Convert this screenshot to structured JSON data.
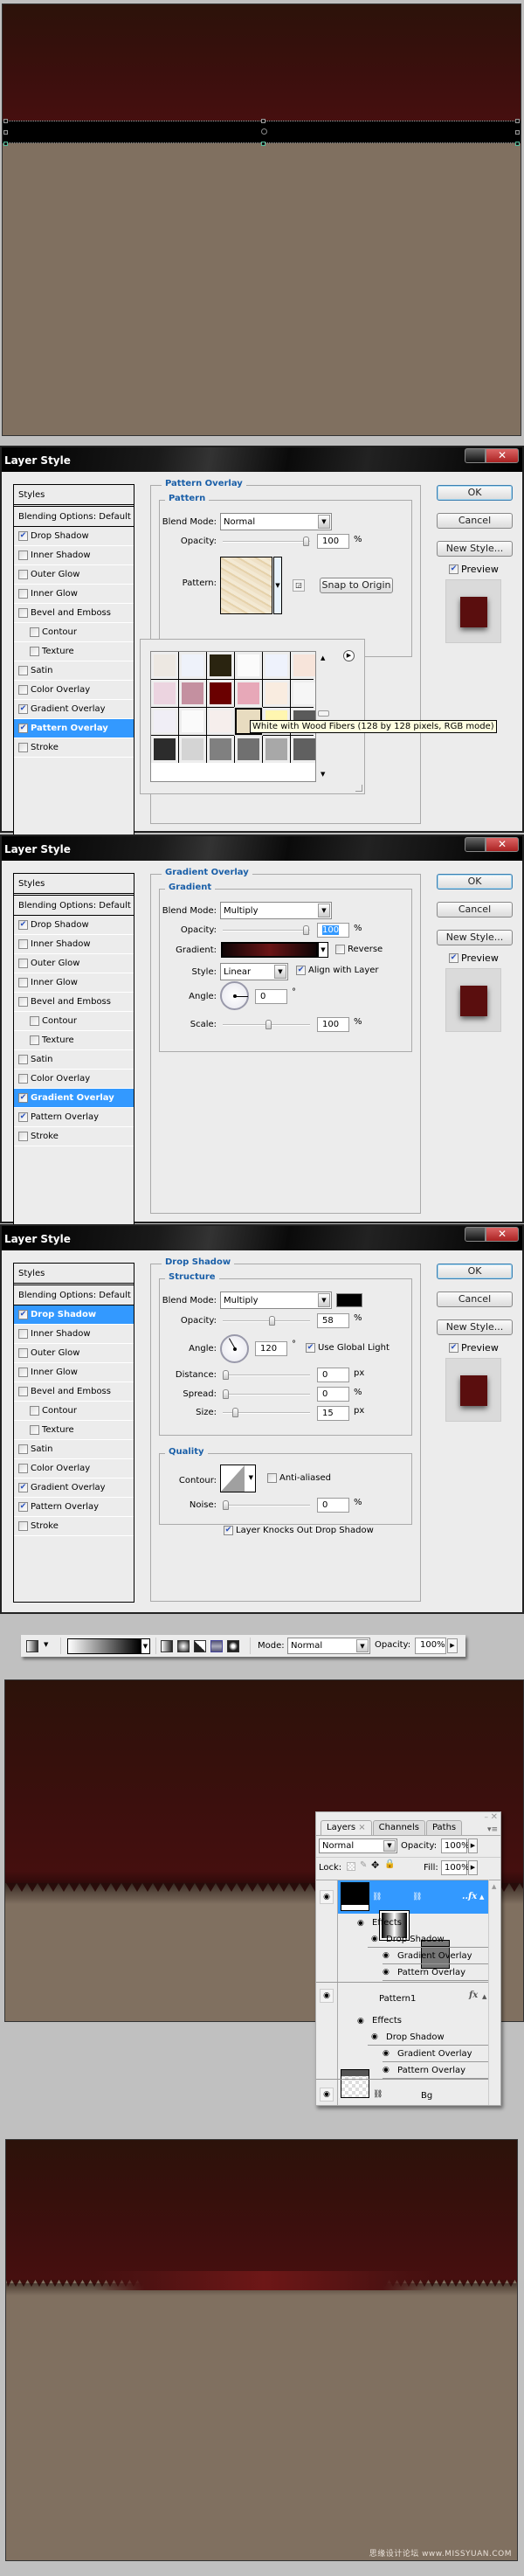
{
  "dialogs": [
    {
      "title": "Layer Style",
      "styles_list": {
        "header": "Styles",
        "blending": "Blending Options: Default",
        "items": [
          {
            "label": "Drop Shadow",
            "checked": true
          },
          {
            "label": "Inner Shadow",
            "checked": false
          },
          {
            "label": "Outer Glow",
            "checked": false
          },
          {
            "label": "Inner Glow",
            "checked": false
          },
          {
            "label": "Bevel and Emboss",
            "checked": false
          },
          {
            "label": "Contour",
            "checked": false,
            "sub": true
          },
          {
            "label": "Texture",
            "checked": false,
            "sub": true
          },
          {
            "label": "Satin",
            "checked": false
          },
          {
            "label": "Color Overlay",
            "checked": false
          },
          {
            "label": "Gradient Overlay",
            "checked": true
          },
          {
            "label": "Pattern Overlay",
            "checked": true,
            "active": true
          },
          {
            "label": "Stroke",
            "checked": false
          }
        ]
      },
      "buttons": {
        "ok": "OK",
        "cancel": "Cancel",
        "new_style": "New Style...",
        "preview": "Preview"
      },
      "section": "Pattern Overlay",
      "subsection": "Pattern",
      "blend_mode_label": "Blend Mode:",
      "blend_mode": "Normal",
      "opacity_label": "Opacity:",
      "opacity": "100",
      "opacity_unit": "%",
      "opacity_fraction": 1.0,
      "pattern_label": "Pattern:",
      "snap_to_origin": "Snap to Origin",
      "picker_tooltip": "White with Wood Fibers (128 by 128 pixels, RGB mode)",
      "picker_colors": [
        "#ede8e2",
        "#eef2fa",
        "#2a2410",
        "#fbfbfb",
        "#eef2fc",
        "#f7e4da",
        "#ecd4e0",
        "#c490a0",
        "#6a0000",
        "#e7a8b8",
        "#f9ece0",
        "#f6f6f6",
        "#f0eef6",
        "#fafafa",
        "#f6eeec",
        "#e8dcc0",
        "#fff6b0",
        "#5a5a5a",
        "#2c2c2c",
        "#d4d4d4",
        "#808080",
        "#707070",
        "#a8a8a8",
        "#606060"
      ],
      "picker_selected_index": 15
    },
    {
      "title": "Layer Style",
      "styles_list_active": "Gradient Overlay",
      "section": "Gradient Overlay",
      "subsection": "Gradient",
      "blend_mode_label": "Blend Mode:",
      "blend_mode": "Multiply",
      "opacity_label": "Opacity:",
      "opacity": "100",
      "opacity_unit": "%",
      "opacity_fraction": 1.0,
      "gradient_label": "Gradient:",
      "reverse_label": "Reverse",
      "reverse_checked": false,
      "style_label": "Style:",
      "style": "Linear",
      "align_label": "Align with Layer",
      "align_checked": true,
      "angle_label": "Angle:",
      "angle": "0",
      "angle_unit": "°",
      "scale_label": "Scale:",
      "scale": "100",
      "scale_unit": "%",
      "scale_fraction": 0.53,
      "gradient_colors": [
        "#0e0405",
        "#6a1416",
        "#0e0405"
      ]
    },
    {
      "title": "Layer Style",
      "styles_list_active": "Drop Shadow",
      "section": "Drop Shadow",
      "subsection": "Structure",
      "blend_mode_label": "Blend Mode:",
      "blend_mode": "Multiply",
      "shadow_color": "#000000",
      "opacity_label": "Opacity:",
      "opacity": "58",
      "opacity_unit": "%",
      "opacity_fraction": 0.58,
      "angle_label": "Angle:",
      "angle": "120",
      "angle_unit": "°",
      "global_light_label": "Use Global Light",
      "global_light_checked": true,
      "distance_label": "Distance:",
      "distance": "0",
      "distance_unit": "px",
      "spread_label": "Spread:",
      "spread": "0",
      "spread_unit": "%",
      "size_label": "Size:",
      "size": "15",
      "size_unit": "px",
      "size_fraction": 0.12,
      "quality_title": "Quality",
      "contour_label": "Contour:",
      "anti_aliased_label": "Anti-aliased",
      "anti_aliased_checked": false,
      "noise_label": "Noise:",
      "noise": "0",
      "noise_unit": "%",
      "knockout_label": "Layer Knocks Out Drop Shadow",
      "knockout_checked": true
    }
  ],
  "toolbar": {
    "mode_label": "Mode:",
    "mode": "Normal",
    "opacity_label": "Opacity:",
    "opacity": "100%"
  },
  "layers_panel": {
    "tabs": [
      "Layers",
      "Channels",
      "Paths"
    ],
    "tab_close": "×",
    "blend_mode": "Normal",
    "opacity_label": "Opacity:",
    "opacity": "100%",
    "lock_label": "Lock:",
    "fill_label": "Fill:",
    "fill": "100%",
    "layers": [
      {
        "name": "",
        "fx": "fx",
        "selected": true,
        "effects_label": "Effects",
        "effects": [
          "Drop Shadow",
          "Gradient Overlay",
          "Pattern Overlay"
        ]
      },
      {
        "name": "Pattern1",
        "fx": "fx",
        "selected": false,
        "effects_label": "Effects",
        "effects": [
          "Drop Shadow",
          "Gradient Overlay",
          "Pattern Overlay"
        ]
      },
      {
        "name": "Bg",
        "selected": false
      }
    ]
  },
  "watermark": "思缘设计论坛 www.MISSYUAN.COM",
  "colors": {
    "canvas_bg": "#807060",
    "dark_red": "#3b0f0d",
    "selection_blue": "#3399ff",
    "section_title": "#1a5fa8"
  }
}
